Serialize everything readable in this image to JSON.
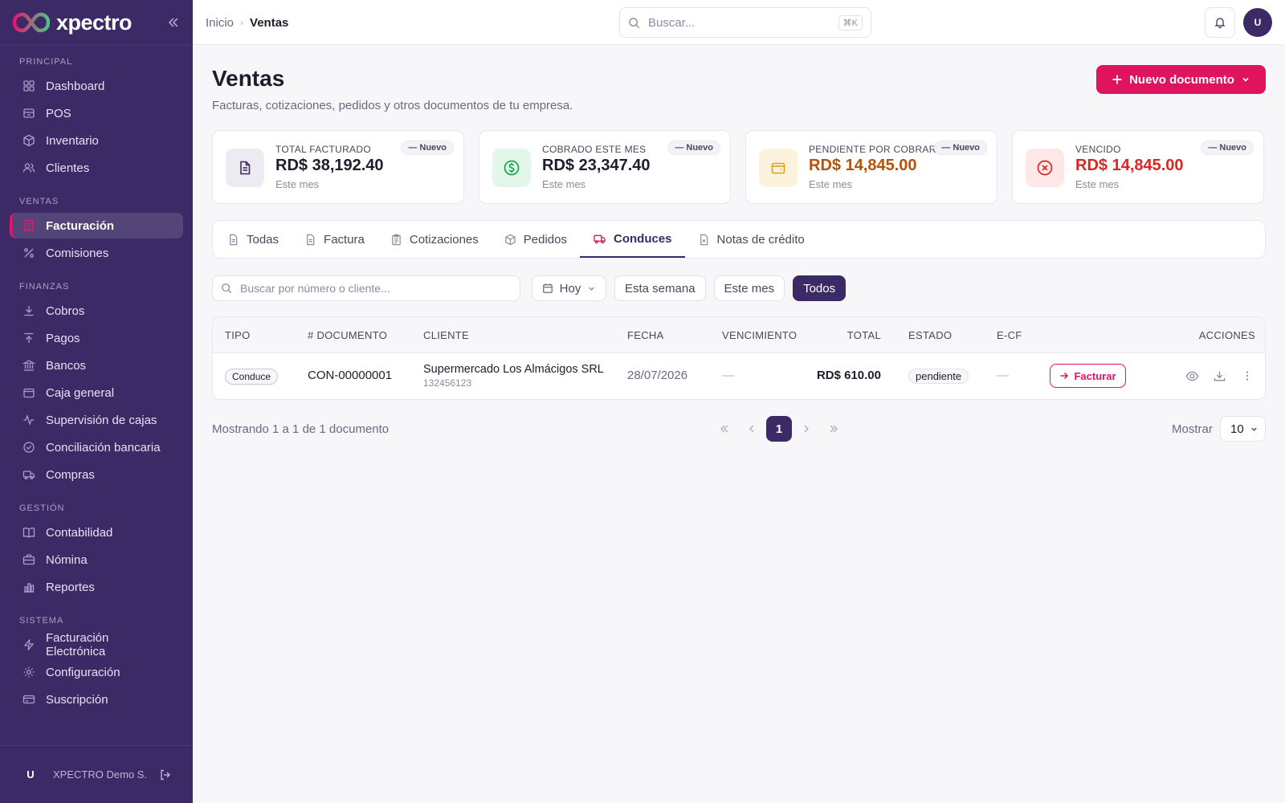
{
  "brand": {
    "name": "xpectro"
  },
  "sidebar": {
    "sections": [
      {
        "label": "PRINCIPAL",
        "items": [
          {
            "label": "Dashboard",
            "icon": "grid-icon"
          },
          {
            "label": "POS",
            "icon": "store-icon"
          },
          {
            "label": "Inventario",
            "icon": "box-icon"
          },
          {
            "label": "Clientes",
            "icon": "users-icon"
          }
        ]
      },
      {
        "label": "VENTAS",
        "items": [
          {
            "label": "Facturación",
            "icon": "receipt-icon",
            "active": true
          },
          {
            "label": "Comisiones",
            "icon": "percent-icon"
          }
        ]
      },
      {
        "label": "FINANZAS",
        "items": [
          {
            "label": "Cobros",
            "icon": "arrow-down-icon"
          },
          {
            "label": "Pagos",
            "icon": "arrow-up-icon"
          },
          {
            "label": "Bancos",
            "icon": "bank-icon"
          },
          {
            "label": "Caja general",
            "icon": "wallet-icon"
          },
          {
            "label": "Supervisión de cajas",
            "icon": "activity-icon"
          },
          {
            "label": "Conciliación bancaria",
            "icon": "check-circle-icon"
          },
          {
            "label": "Compras",
            "icon": "truck-icon"
          }
        ]
      },
      {
        "label": "GESTIÓN",
        "items": [
          {
            "label": "Contabilidad",
            "icon": "book-icon"
          },
          {
            "label": "Nómina",
            "icon": "briefcase-icon"
          },
          {
            "label": "Reportes",
            "icon": "bar-chart-icon"
          }
        ]
      },
      {
        "label": "SISTEMA",
        "items": [
          {
            "label": "Facturación Electrónica",
            "icon": "lightning-icon"
          },
          {
            "label": "Configuración",
            "icon": "gear-icon"
          },
          {
            "label": "Suscripción",
            "icon": "card-icon"
          }
        ]
      }
    ],
    "footer": {
      "avatar": "U",
      "company": "XPECTRO Demo S..."
    }
  },
  "topbar": {
    "breadcrumb": {
      "home": "Inicio",
      "current": "Ventas"
    },
    "search_placeholder": "Buscar...",
    "search_shortcut": "⌘K",
    "avatar": "U"
  },
  "page": {
    "title": "Ventas",
    "subtitle": "Facturas, cotizaciones, pedidos y otros documentos de tu empresa.",
    "new_button": "Nuevo documento"
  },
  "stats": [
    {
      "label": "TOTAL FACTURADO",
      "value": "RD$ 38,192.40",
      "sub": "Este mes",
      "badge": "— Nuevo",
      "icon": "document-icon",
      "accent": "#1f1d2b",
      "icon_bg": "#ecebf1",
      "icon_color": "#3b2a66"
    },
    {
      "label": "COBRADO ESTE MES",
      "value": "RD$ 23,347.40",
      "sub": "Este mes",
      "badge": "— Nuevo",
      "icon": "dollar-circle-icon",
      "accent": "#1f1d2b",
      "icon_bg": "#e3f6ea",
      "icon_color": "#16a34a"
    },
    {
      "label": "PENDIENTE POR COBRAR",
      "value": "RD$ 14,845.00",
      "sub": "Este mes",
      "badge": "— Nuevo",
      "icon": "wallet-icon",
      "accent": "#b45309",
      "icon_bg": "#fdf3dd",
      "icon_color": "#d9a21b"
    },
    {
      "label": "VENCIDO",
      "value": "RD$ 14,845.00",
      "sub": "Este mes",
      "badge": "— Nuevo",
      "icon": "x-circle-icon",
      "accent": "#dc2626",
      "icon_bg": "#fde7e7",
      "icon_color": "#dc2626"
    }
  ],
  "tabs": [
    {
      "label": "Todas",
      "icon": "document-icon"
    },
    {
      "label": "Factura",
      "icon": "document-icon"
    },
    {
      "label": "Cotizaciones",
      "icon": "clipboard-icon"
    },
    {
      "label": "Pedidos",
      "icon": "box-icon"
    },
    {
      "label": "Conduces",
      "icon": "truck-icon",
      "active": true
    },
    {
      "label": "Notas de crédito",
      "icon": "document-x-icon"
    }
  ],
  "filters": {
    "search_placeholder": "Buscar por número o cliente...",
    "date_select": "Hoy",
    "chips": [
      {
        "label": "Esta semana"
      },
      {
        "label": "Este mes"
      },
      {
        "label": "Todos",
        "active": true
      }
    ]
  },
  "table": {
    "headers": [
      "TIPO",
      "# DOCUMENTO",
      "CLIENTE",
      "FECHA",
      "VENCIMIENTO",
      "TOTAL",
      "ESTADO",
      "E-CF",
      "ACCIONES"
    ],
    "rows": [
      {
        "tipo": "Conduce",
        "documento": "CON-00000001",
        "cliente": "Supermercado Los Almácigos SRL",
        "cliente_id": "132456123",
        "fecha": "28/07/2026",
        "vencimiento": "—",
        "total": "RD$ 610.00",
        "estado": "pendiente",
        "ecf": "—",
        "action_label": "Facturar"
      }
    ]
  },
  "pagination": {
    "info": "Mostrando 1 a 1 de 1 documento",
    "current_page": "1",
    "show_label": "Mostrar",
    "page_size": "10"
  }
}
